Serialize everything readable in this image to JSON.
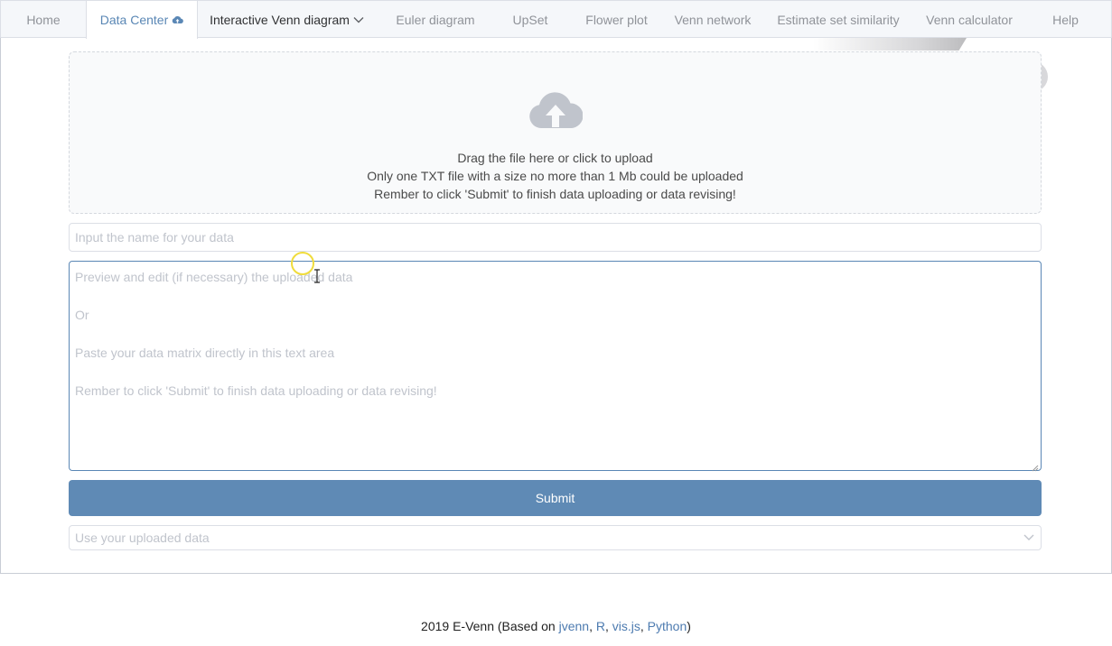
{
  "nav": {
    "tabs": [
      {
        "label": "Home"
      },
      {
        "label": "Data Center"
      },
      {
        "label": "Interactive Venn diagram"
      },
      {
        "label": "Euler diagram"
      },
      {
        "label": "UpSet"
      },
      {
        "label": "Flower plot"
      },
      {
        "label": "Venn network"
      },
      {
        "label": "Estimate set similarity"
      },
      {
        "label": "Venn calculator"
      },
      {
        "label": "Help"
      }
    ],
    "active": "Data Center"
  },
  "upload": {
    "icon": "cloud-upload-icon",
    "line1": "Drag the file here or click to upload",
    "line2": "Only one TXT file with a size no more than 1 Mb could be uploaded",
    "line3": "Rember to click 'Submit' to finish data uploading or data revising!"
  },
  "form": {
    "name_placeholder": "Input the name for your data",
    "name_value": "",
    "data_placeholder": "Preview and edit (if necessary) the uploaded data\n\nOr\n\nPaste your data matrix directly in this text area\n\nRember to click 'Submit' to finish data uploading or data revising!",
    "data_value": "",
    "submit_label": "Submit",
    "select_placeholder": "Use your uploaded data"
  },
  "footer": {
    "prefix": "2019 E-Venn (Based on ",
    "links": [
      "jvenn",
      "R",
      "vis.js",
      "Python"
    ],
    "sep1": ", ",
    "sep2": ", ",
    "sep3": ", ",
    "suffix": ")"
  },
  "colors": {
    "accent": "#5f8ab5",
    "active_tab_text": "#5a87b5",
    "link": "#4d7bb0"
  }
}
